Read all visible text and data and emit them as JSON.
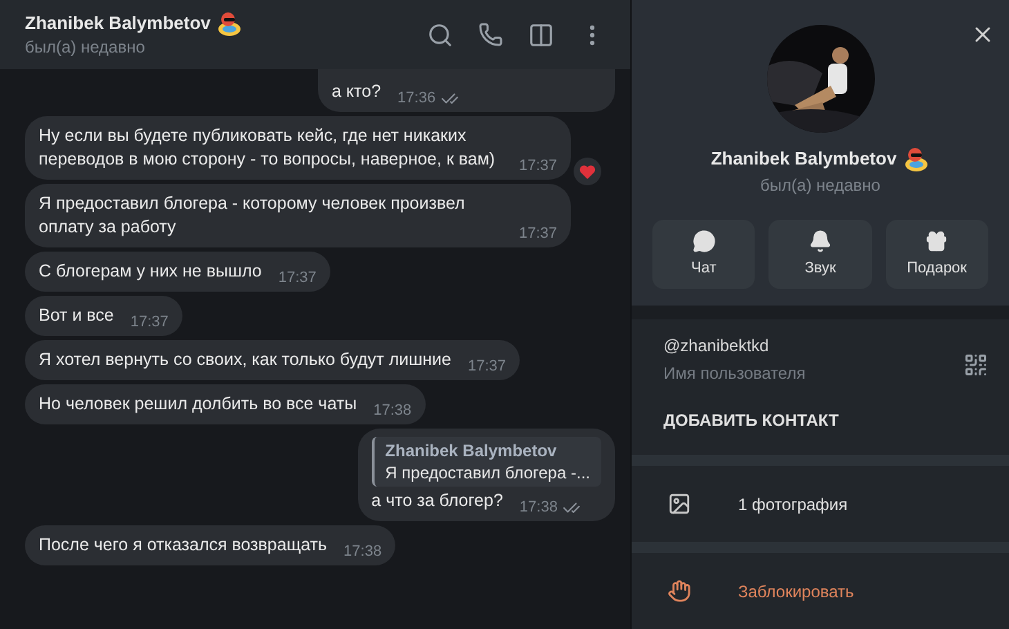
{
  "header": {
    "name": "Zhanibek Balymbetov",
    "status": "был(а) недавно"
  },
  "messages": [
    {
      "kind": "out",
      "text": "а кто?",
      "time": "17:36",
      "read": true
    },
    {
      "kind": "in",
      "text": "Ну если вы будете публиковать кейс, где нет никаких переводов в мою сторону - то вопросы, наверное, к вам)",
      "time": "17:37",
      "reaction": true
    },
    {
      "kind": "in",
      "text": "Я предоставил блогера - которому человек произвел оплату за работу",
      "time": "17:37"
    },
    {
      "kind": "in",
      "text": "С блогерам у них не вышло",
      "time": "17:37"
    },
    {
      "kind": "in",
      "text": "Вот и все",
      "time": "17:37"
    },
    {
      "kind": "in",
      "text": "Я хотел вернуть со своих, как только будут лишние",
      "time": "17:37"
    },
    {
      "kind": "in",
      "text": "Но человек решил долбить во все чаты",
      "time": "17:38"
    },
    {
      "kind": "out",
      "reply": {
        "name": "Zhanibek Balymbetov",
        "text": "Я предоставил блогера -..."
      },
      "text": "а что за блогер?",
      "time": "17:38",
      "read": true
    },
    {
      "kind": "in",
      "text": "После чего я отказался возвращать",
      "time": "17:38"
    }
  ],
  "profile": {
    "name": "Zhanibek Balymbetov",
    "status": "был(а) недавно",
    "actions": [
      {
        "kind": "chat",
        "label": "Чат"
      },
      {
        "kind": "sound",
        "label": "Звук"
      },
      {
        "kind": "gift",
        "label": "Подарок"
      }
    ],
    "username": "@zhanibektkd",
    "username_caption": "Имя пользователя",
    "add_contact": "ДОБАВИТЬ КОНТАКТ",
    "photos": "1 фотография",
    "block": "Заблокировать"
  }
}
